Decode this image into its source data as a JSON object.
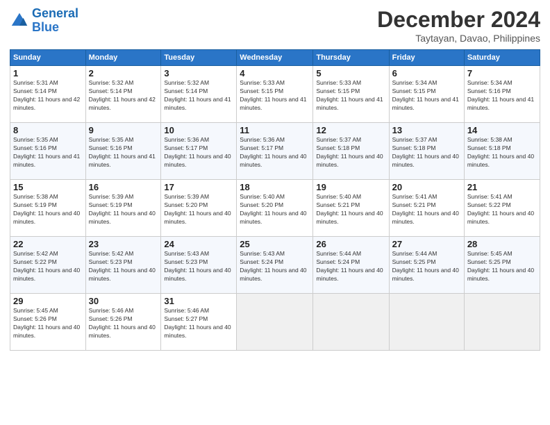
{
  "logo": {
    "line1": "General",
    "line2": "Blue"
  },
  "title": "December 2024",
  "location": "Taytayan, Davao, Philippines",
  "days_header": [
    "Sunday",
    "Monday",
    "Tuesday",
    "Wednesday",
    "Thursday",
    "Friday",
    "Saturday"
  ],
  "weeks": [
    [
      {
        "day": "1",
        "sunrise": "5:31 AM",
        "sunset": "5:14 PM",
        "daylight": "11 hours and 42 minutes."
      },
      {
        "day": "2",
        "sunrise": "5:32 AM",
        "sunset": "5:14 PM",
        "daylight": "11 hours and 42 minutes."
      },
      {
        "day": "3",
        "sunrise": "5:32 AM",
        "sunset": "5:14 PM",
        "daylight": "11 hours and 41 minutes."
      },
      {
        "day": "4",
        "sunrise": "5:33 AM",
        "sunset": "5:15 PM",
        "daylight": "11 hours and 41 minutes."
      },
      {
        "day": "5",
        "sunrise": "5:33 AM",
        "sunset": "5:15 PM",
        "daylight": "11 hours and 41 minutes."
      },
      {
        "day": "6",
        "sunrise": "5:34 AM",
        "sunset": "5:15 PM",
        "daylight": "11 hours and 41 minutes."
      },
      {
        "day": "7",
        "sunrise": "5:34 AM",
        "sunset": "5:16 PM",
        "daylight": "11 hours and 41 minutes."
      }
    ],
    [
      {
        "day": "8",
        "sunrise": "5:35 AM",
        "sunset": "5:16 PM",
        "daylight": "11 hours and 41 minutes."
      },
      {
        "day": "9",
        "sunrise": "5:35 AM",
        "sunset": "5:16 PM",
        "daylight": "11 hours and 41 minutes."
      },
      {
        "day": "10",
        "sunrise": "5:36 AM",
        "sunset": "5:17 PM",
        "daylight": "11 hours and 40 minutes."
      },
      {
        "day": "11",
        "sunrise": "5:36 AM",
        "sunset": "5:17 PM",
        "daylight": "11 hours and 40 minutes."
      },
      {
        "day": "12",
        "sunrise": "5:37 AM",
        "sunset": "5:18 PM",
        "daylight": "11 hours and 40 minutes."
      },
      {
        "day": "13",
        "sunrise": "5:37 AM",
        "sunset": "5:18 PM",
        "daylight": "11 hours and 40 minutes."
      },
      {
        "day": "14",
        "sunrise": "5:38 AM",
        "sunset": "5:18 PM",
        "daylight": "11 hours and 40 minutes."
      }
    ],
    [
      {
        "day": "15",
        "sunrise": "5:38 AM",
        "sunset": "5:19 PM",
        "daylight": "11 hours and 40 minutes."
      },
      {
        "day": "16",
        "sunrise": "5:39 AM",
        "sunset": "5:19 PM",
        "daylight": "11 hours and 40 minutes."
      },
      {
        "day": "17",
        "sunrise": "5:39 AM",
        "sunset": "5:20 PM",
        "daylight": "11 hours and 40 minutes."
      },
      {
        "day": "18",
        "sunrise": "5:40 AM",
        "sunset": "5:20 PM",
        "daylight": "11 hours and 40 minutes."
      },
      {
        "day": "19",
        "sunrise": "5:40 AM",
        "sunset": "5:21 PM",
        "daylight": "11 hours and 40 minutes."
      },
      {
        "day": "20",
        "sunrise": "5:41 AM",
        "sunset": "5:21 PM",
        "daylight": "11 hours and 40 minutes."
      },
      {
        "day": "21",
        "sunrise": "5:41 AM",
        "sunset": "5:22 PM",
        "daylight": "11 hours and 40 minutes."
      }
    ],
    [
      {
        "day": "22",
        "sunrise": "5:42 AM",
        "sunset": "5:22 PM",
        "daylight": "11 hours and 40 minutes."
      },
      {
        "day": "23",
        "sunrise": "5:42 AM",
        "sunset": "5:23 PM",
        "daylight": "11 hours and 40 minutes."
      },
      {
        "day": "24",
        "sunrise": "5:43 AM",
        "sunset": "5:23 PM",
        "daylight": "11 hours and 40 minutes."
      },
      {
        "day": "25",
        "sunrise": "5:43 AM",
        "sunset": "5:24 PM",
        "daylight": "11 hours and 40 minutes."
      },
      {
        "day": "26",
        "sunrise": "5:44 AM",
        "sunset": "5:24 PM",
        "daylight": "11 hours and 40 minutes."
      },
      {
        "day": "27",
        "sunrise": "5:44 AM",
        "sunset": "5:25 PM",
        "daylight": "11 hours and 40 minutes."
      },
      {
        "day": "28",
        "sunrise": "5:45 AM",
        "sunset": "5:25 PM",
        "daylight": "11 hours and 40 minutes."
      }
    ],
    [
      {
        "day": "29",
        "sunrise": "5:45 AM",
        "sunset": "5:26 PM",
        "daylight": "11 hours and 40 minutes."
      },
      {
        "day": "30",
        "sunrise": "5:46 AM",
        "sunset": "5:26 PM",
        "daylight": "11 hours and 40 minutes."
      },
      {
        "day": "31",
        "sunrise": "5:46 AM",
        "sunset": "5:27 PM",
        "daylight": "11 hours and 40 minutes."
      },
      null,
      null,
      null,
      null
    ]
  ]
}
